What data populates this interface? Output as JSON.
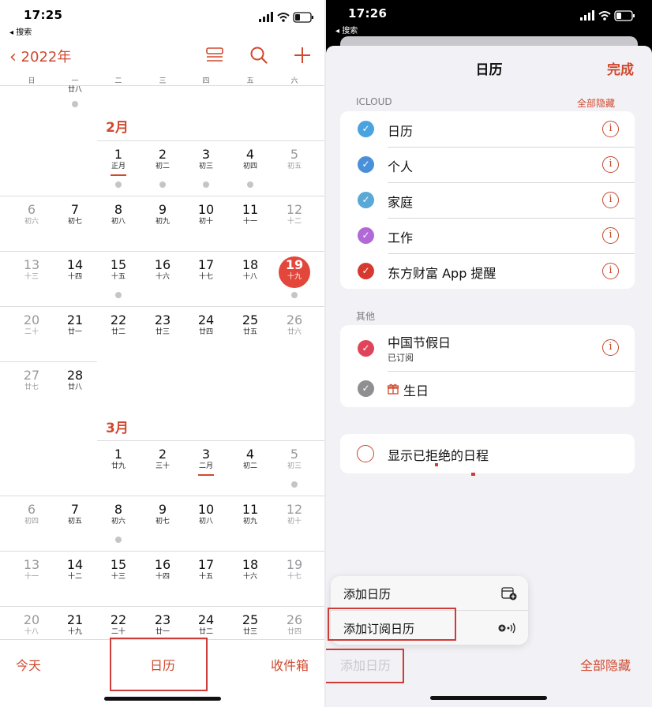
{
  "left": {
    "status": {
      "time": "17:25",
      "back": "◂ 搜索"
    },
    "nav": {
      "year_back": "2022年"
    },
    "weekdays": [
      "日",
      "一",
      "二",
      "三",
      "四",
      "五",
      "六"
    ],
    "prev_peek": {
      "lunar": "廿八"
    },
    "feb": {
      "title": "2月",
      "weeks": [
        [
          {
            "d": "",
            "l": ""
          },
          {
            "d": "",
            "l": ""
          },
          {
            "d": "1",
            "l": "正月"
          },
          {
            "d": "2",
            "l": "初二"
          },
          {
            "d": "3",
            "l": "初三"
          },
          {
            "d": "4",
            "l": "初四"
          },
          {
            "d": "5",
            "l": "初五"
          }
        ],
        [
          {
            "d": "6",
            "l": "初六"
          },
          {
            "d": "7",
            "l": "初七"
          },
          {
            "d": "8",
            "l": "初八"
          },
          {
            "d": "9",
            "l": "初九"
          },
          {
            "d": "10",
            "l": "初十"
          },
          {
            "d": "11",
            "l": "十一"
          },
          {
            "d": "12",
            "l": "十二"
          }
        ],
        [
          {
            "d": "13",
            "l": "十三"
          },
          {
            "d": "14",
            "l": "十四"
          },
          {
            "d": "15",
            "l": "十五"
          },
          {
            "d": "16",
            "l": "十六"
          },
          {
            "d": "17",
            "l": "十七"
          },
          {
            "d": "18",
            "l": "十八"
          },
          {
            "d": "19",
            "l": "十九"
          }
        ],
        [
          {
            "d": "20",
            "l": "二十"
          },
          {
            "d": "21",
            "l": "廿一"
          },
          {
            "d": "22",
            "l": "廿二"
          },
          {
            "d": "23",
            "l": "廿三"
          },
          {
            "d": "24",
            "l": "廿四"
          },
          {
            "d": "25",
            "l": "廿五"
          },
          {
            "d": "26",
            "l": "廿六"
          }
        ],
        [
          {
            "d": "27",
            "l": "廿七"
          },
          {
            "d": "28",
            "l": "廿八"
          }
        ]
      ]
    },
    "mar": {
      "title": "3月",
      "weeks": [
        [
          {
            "d": "",
            "l": ""
          },
          {
            "d": "",
            "l": ""
          },
          {
            "d": "1",
            "l": "廿九"
          },
          {
            "d": "2",
            "l": "三十"
          },
          {
            "d": "3",
            "l": "二月"
          },
          {
            "d": "4",
            "l": "初二"
          },
          {
            "d": "5",
            "l": "初三"
          }
        ],
        [
          {
            "d": "6",
            "l": "初四"
          },
          {
            "d": "7",
            "l": "初五"
          },
          {
            "d": "8",
            "l": "初六"
          },
          {
            "d": "9",
            "l": "初七"
          },
          {
            "d": "10",
            "l": "初八"
          },
          {
            "d": "11",
            "l": "初九"
          },
          {
            "d": "12",
            "l": "初十"
          }
        ],
        [
          {
            "d": "13",
            "l": "十一"
          },
          {
            "d": "14",
            "l": "十二"
          },
          {
            "d": "15",
            "l": "十三"
          },
          {
            "d": "16",
            "l": "十四"
          },
          {
            "d": "17",
            "l": "十五"
          },
          {
            "d": "18",
            "l": "十六"
          },
          {
            "d": "19",
            "l": "十七"
          }
        ],
        [
          {
            "d": "20",
            "l": "十八"
          },
          {
            "d": "21",
            "l": "十九"
          },
          {
            "d": "22",
            "l": "二十"
          },
          {
            "d": "23",
            "l": "廿一"
          },
          {
            "d": "24",
            "l": "廿二"
          },
          {
            "d": "25",
            "l": "廿三"
          },
          {
            "d": "26",
            "l": "廿四"
          }
        ]
      ]
    },
    "today_date": "19",
    "toolbar": {
      "today": "今天",
      "calendars": "日历",
      "inbox": "收件箱"
    }
  },
  "right": {
    "status": {
      "time": "17:26",
      "back": "◂ 搜索"
    },
    "header": {
      "title": "日历",
      "done": "完成"
    },
    "icloud": {
      "section": "ICLOUD",
      "hide_all": "全部隐藏",
      "items": [
        {
          "label": "日历",
          "color": "#4aa3df"
        },
        {
          "label": "个人",
          "color": "#4a90d9"
        },
        {
          "label": "家庭",
          "color": "#5aa8d6"
        },
        {
          "label": "工作",
          "color": "#b069d6"
        },
        {
          "label": "东方财富 App 提醒",
          "color": "#d63a2f"
        }
      ]
    },
    "other": {
      "section": "其他",
      "items": [
        {
          "label": "中国节假日",
          "sub": "已订阅",
          "color": "#e0445a"
        },
        {
          "label": "生日",
          "color": "#8e8e93"
        }
      ]
    },
    "declined": {
      "label": "显示已拒绝的日程"
    },
    "popup": {
      "add_calendar": "添加日历",
      "add_subscribed": "添加订阅日历"
    },
    "toolbar": {
      "add_calendar": "添加日历",
      "hide_all": "全部隐藏"
    }
  },
  "colors": {
    "accent": "#d0492f",
    "today": "#e3463a",
    "highlight_box": "#cf3b37"
  }
}
